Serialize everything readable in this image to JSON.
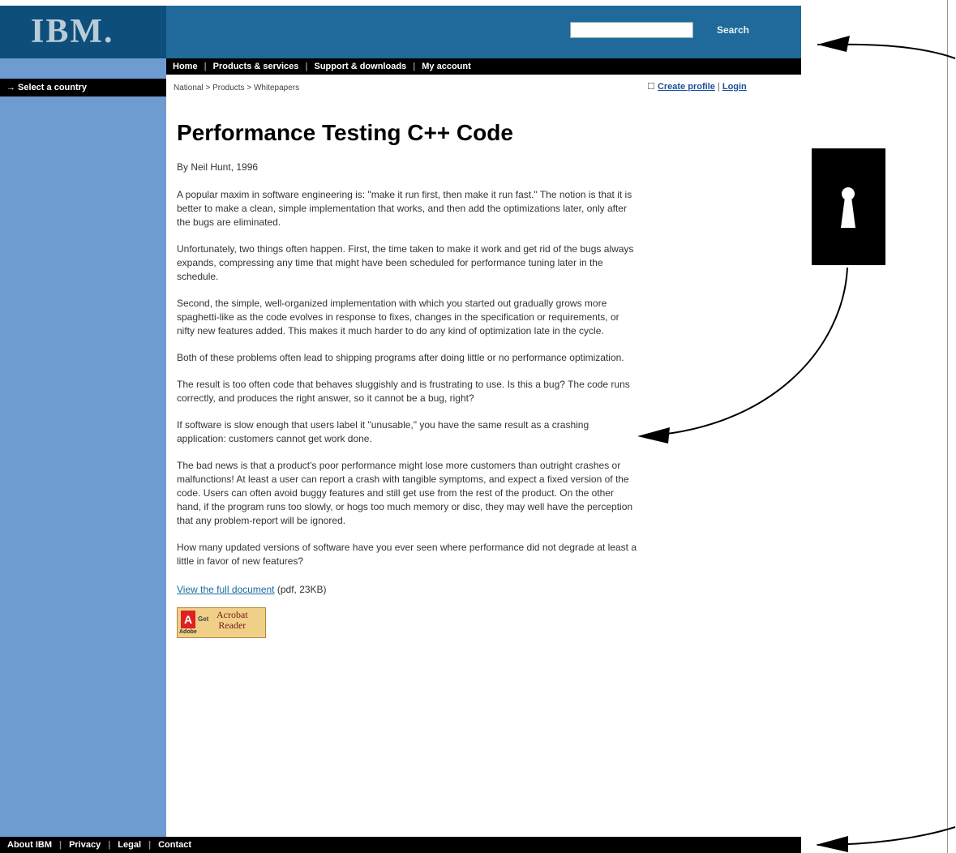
{
  "header": {
    "logo": "IBM.",
    "search_button_label": "Search",
    "search_value": ""
  },
  "nav": {
    "items": [
      "Home",
      "Products & services",
      "Support & downloads",
      "My account"
    ]
  },
  "left_rail": {
    "country_label": "→ Select a country"
  },
  "breadcrumb": "National  >  Products  >  Whitepapers",
  "profile": {
    "create_label": "Create profile",
    "login_label": "Login"
  },
  "article": {
    "title": "Performance Testing C++ Code",
    "byline": "By Neil Hunt, 1996",
    "paragraphs": [
      "A popular maxim in software engineering is: \"make it run first, then make it run fast.\" The notion is that it is better to make a clean, simple implementation that works, and then add the optimizations later, only after the bugs are eliminated.",
      "Unfortunately, two things often happen. First, the time taken to make it work and get rid of the bugs always expands, compressing any time that might have been scheduled for performance tuning later in the schedule.",
      "Second, the simple, well-organized implementation with which you started out gradually grows more spaghetti-like as the code evolves in response to fixes, changes in the specification or requirements, or nifty new features added. This makes it much harder to do any kind of optimization late in the cycle.",
      "Both of these problems often lead to shipping programs after doing little or no performance optimization.",
      "The result is too often code that behaves sluggishly and is frustrating to use. Is this a bug? The code runs correctly, and produces the right answer, so it cannot be a bug, right?",
      "If software is slow enough that users label it \"unusable,\" you have the same result as a crashing application: customers cannot get work done.",
      "The bad news is that a product's poor performance might lose more customers than outright crashes or malfunctions! At least a user can report a crash with tangible symptoms, and expect a fixed version of the code. Users can often avoid buggy features and still get use from the rest of the product. On the other hand, if the program runs too slowly, or hogs too much memory or disc, they may well have the perception that any problem-report will be ignored.",
      "How many updated versions of software have you ever seen where performance did not degrade at least a little in favor of new features?"
    ],
    "doc_link_label": "View the full document",
    "doc_link_meta": " (pdf, 23KB)",
    "acrobat": {
      "brand_mark": "A",
      "brand_word": "Adobe",
      "get_label": "Get",
      "reader_line1": "Acrobat",
      "reader_line2": "Reader"
    }
  },
  "footer": {
    "items": [
      "About IBM",
      "Privacy",
      "Legal",
      "Contact"
    ]
  },
  "colors": {
    "masthead": "#1f6a9a",
    "rail": "#6e9bd0",
    "link": "#1a6aa0"
  }
}
